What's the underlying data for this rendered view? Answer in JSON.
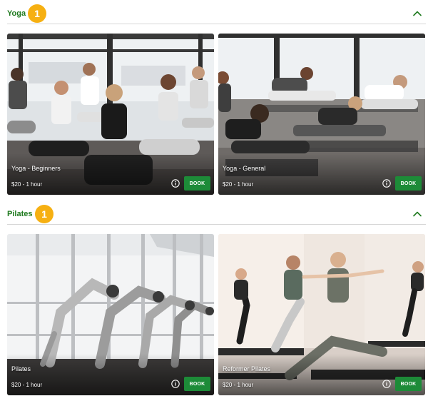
{
  "sections": [
    {
      "title": "Yoga",
      "count": "1",
      "classes": [
        {
          "name": "Yoga - Beginners",
          "price": "$20 - 1 hour",
          "book_label": "BOOK"
        },
        {
          "name": "Yoga - General",
          "price": "$20 - 1 hour",
          "book_label": "BOOK"
        }
      ]
    },
    {
      "title": "Pilates",
      "count": "1",
      "classes": [
        {
          "name": "Pilates",
          "price": "$20 - 1 hour",
          "book_label": "BOOK"
        },
        {
          "name": "Reformer Pilates",
          "price": "$20 - 1 hour",
          "book_label": "BOOK"
        }
      ]
    }
  ],
  "icons": {
    "collapse": "chevron-up-icon",
    "info": "info-icon",
    "badge": "count-badge"
  },
  "colors": {
    "section_title": "#1f7a1f",
    "badge": "#f6b012",
    "book_button": "#1d8b38",
    "divider": "#d6d6d6"
  }
}
